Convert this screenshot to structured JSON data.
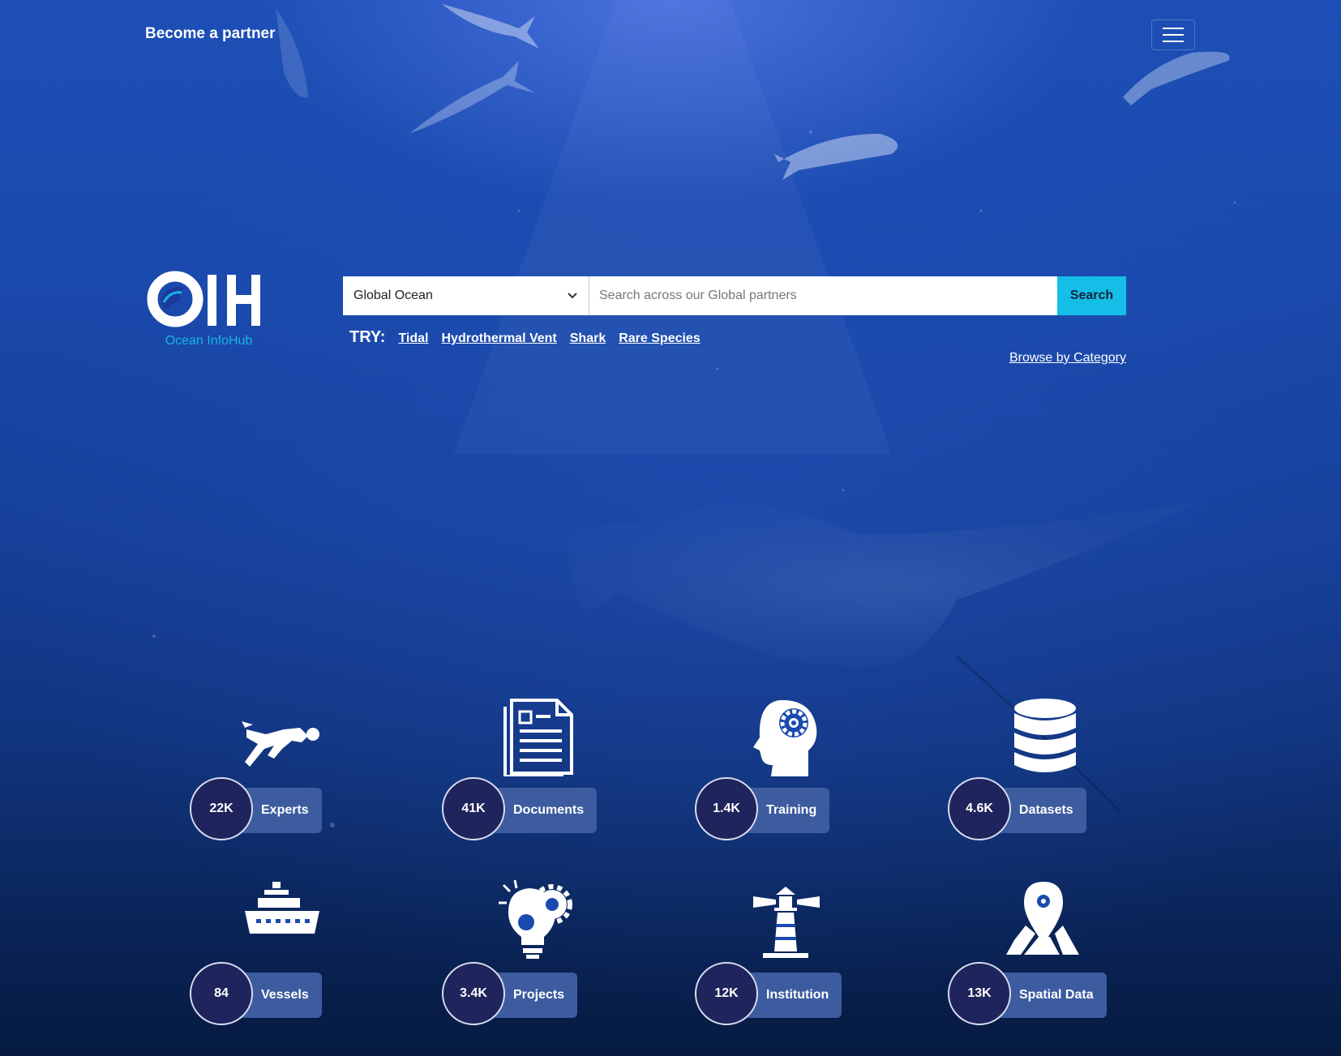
{
  "nav": {
    "partner_label": "Become a partner",
    "menu_icon": "hamburger-icon"
  },
  "brand": {
    "logo_text": "OIH",
    "name": "Ocean InfoHub",
    "accent_color": "#17b4e6"
  },
  "search": {
    "region_value": "Global Ocean",
    "placeholder": "Search across our Global partners",
    "button_label": "Search",
    "button_color": "#14bee6"
  },
  "suggestions": {
    "label": "TRY:",
    "items": [
      "Tidal",
      "Hydrothermal Vent",
      "Shark",
      "Rare Species"
    ]
  },
  "browse_label": "Browse by Category",
  "stats": [
    {
      "count": "22K",
      "label": "Experts",
      "icon": "diver-icon"
    },
    {
      "count": "41K",
      "label": "Documents",
      "icon": "document-icon"
    },
    {
      "count": "1.4K",
      "label": "Training",
      "icon": "head-gear-icon"
    },
    {
      "count": "4.6K",
      "label": "Datasets",
      "icon": "database-icon"
    },
    {
      "count": "84",
      "label": "Vessels",
      "icon": "ship-icon"
    },
    {
      "count": "3.4K",
      "label": "Projects",
      "icon": "lightbulb-gear-icon"
    },
    {
      "count": "12K",
      "label": "Institution",
      "icon": "lighthouse-icon"
    },
    {
      "count": "13K",
      "label": "Spatial Data",
      "icon": "map-pin-icon"
    }
  ]
}
